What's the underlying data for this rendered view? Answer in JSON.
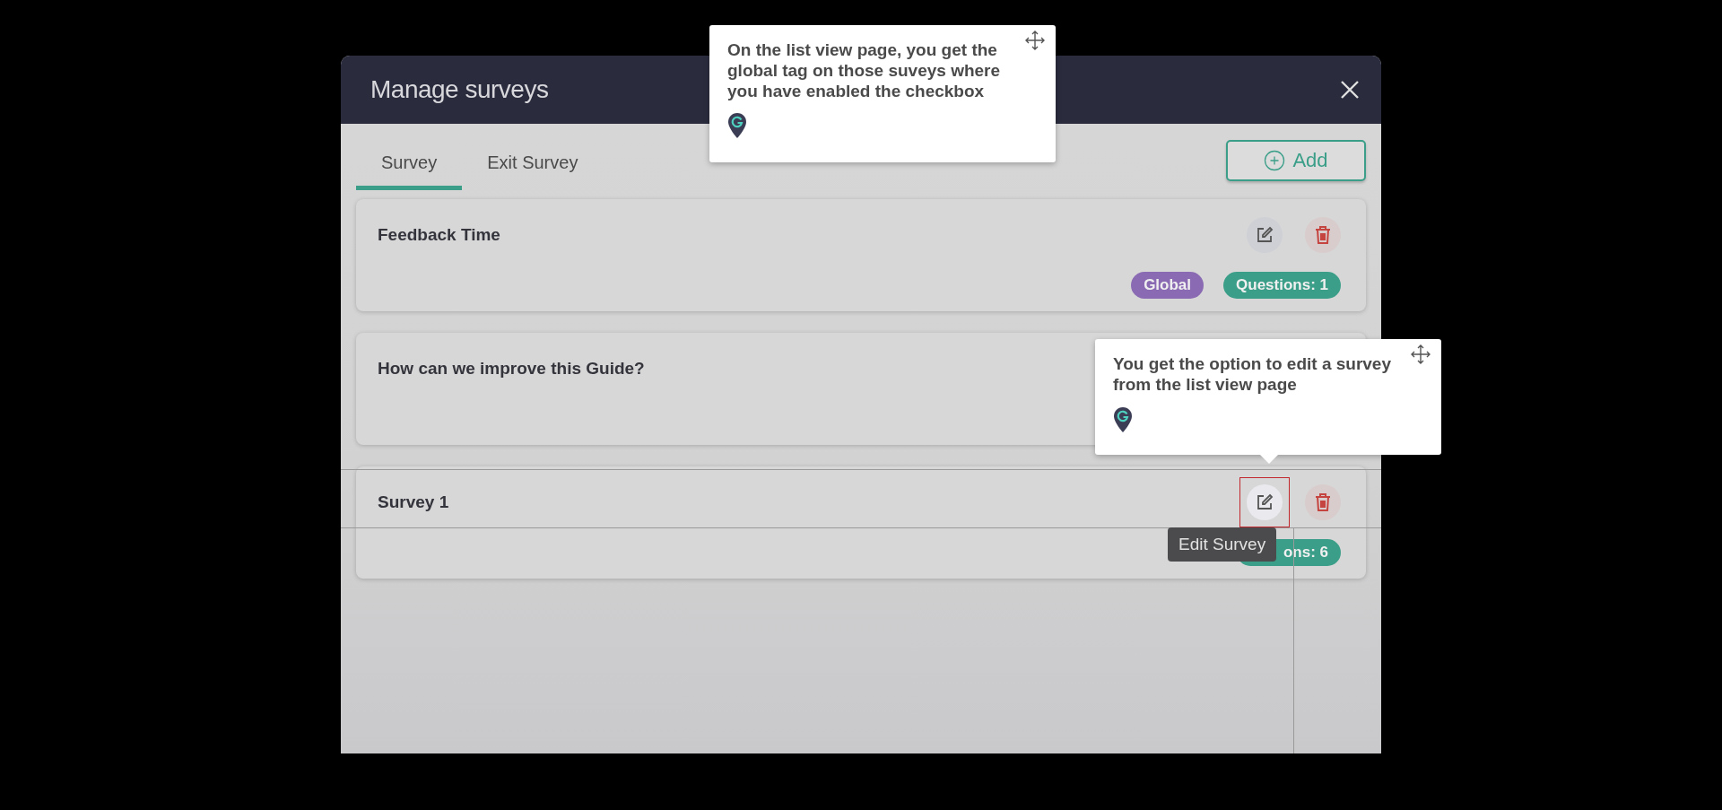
{
  "dialog": {
    "title": "Manage surveys",
    "tabs": [
      {
        "label": "Survey",
        "selected": true
      },
      {
        "label": "Exit Survey",
        "selected": false
      }
    ],
    "add_button": "Add",
    "surveys": [
      {
        "title": "Feedback Time",
        "actions": true,
        "badges": [
          {
            "kind": "global",
            "label": "Global"
          },
          {
            "kind": "count",
            "label": "Questions: 1"
          }
        ]
      },
      {
        "title": "How can we improve this Guide?"
      },
      {
        "title": "Survey 1",
        "actions": true,
        "highlighted": true,
        "badges": [
          {
            "kind": "count",
            "label": "ons: 6"
          }
        ]
      }
    ]
  },
  "hints": [
    {
      "kind": "top",
      "text": "On the list view page, you get the global tag on those suveys where you have enabled the checkbox"
    },
    {
      "kind": "pointer",
      "text": "You get the option to edit a survey from the list view page"
    }
  ],
  "hover_tooltip": "Edit Survey"
}
